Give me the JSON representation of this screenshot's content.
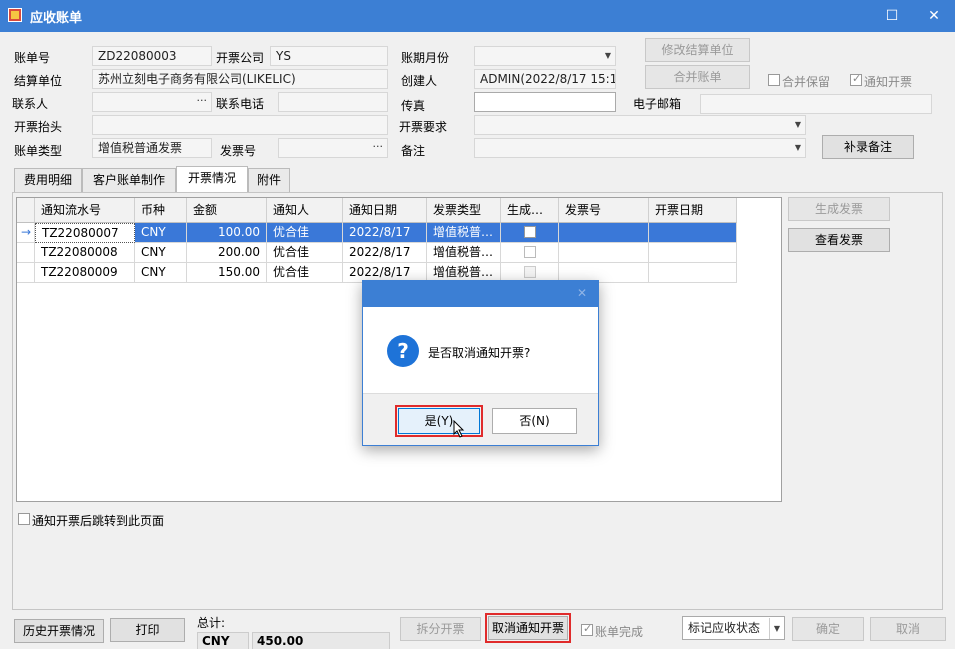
{
  "window": {
    "title": "应收账单",
    "minimize": "☐",
    "close": "✕"
  },
  "form": {
    "bill_no_label": "账单号",
    "bill_no": "ZD22080003",
    "invoice_company_label": "开票公司",
    "invoice_company": "YS",
    "period_label": "账期月份",
    "period": "",
    "settle_unit_label": "结算单位",
    "settle_unit": "苏州立刻电子商务有限公司(LIKELIC)",
    "creator_label": "创建人",
    "creator": "ADMIN(2022/8/17 15:1",
    "contact_label": "联系人",
    "contact": "",
    "phone_label": "联系电话",
    "phone": "",
    "fax_label": "传真",
    "fax": "",
    "email_label": "电子邮箱",
    "email": "",
    "invoice_title_label": "开票抬头",
    "invoice_title": "",
    "invoice_req_label": "开票要求",
    "invoice_req": "",
    "bill_type_label": "账单类型",
    "bill_type": "增值税普通发票",
    "invoice_no_label": "发票号",
    "invoice_no": "",
    "remark_label": "备注",
    "remark": ""
  },
  "buttons": {
    "modify_settle": "修改结算单位",
    "merge_bill": "合并账单",
    "add_remark": "补录备注",
    "gen_invoice": "生成发票",
    "view_invoice": "查看发票",
    "history": "历史开票情况",
    "print": "打印",
    "split": "拆分开票",
    "cancel_notify": "取消通知开票",
    "confirm": "确定",
    "cancel": "取消"
  },
  "checks": {
    "merge_keep": "合并保留",
    "notify": "通知开票",
    "jump": "通知开票后跳转到此页面",
    "bill_done": "账单完成"
  },
  "tabs": [
    "费用明细",
    "客户账单制作",
    "开票情况",
    "附件"
  ],
  "table": {
    "headers": [
      "通知流水号",
      "币种",
      "金额",
      "通知人",
      "通知日期",
      "发票类型",
      "生成…",
      "发票号",
      "开票日期"
    ],
    "rows": [
      {
        "marker": "→",
        "id": "TZ22080007",
        "currency": "CNY",
        "amount": "100.00",
        "notifier": "优合佳",
        "date": "2022/8/17",
        "type": "增值税普…"
      },
      {
        "marker": "",
        "id": "TZ22080008",
        "currency": "CNY",
        "amount": "200.00",
        "notifier": "优合佳",
        "date": "2022/8/17",
        "type": "增值税普…"
      },
      {
        "marker": "",
        "id": "TZ22080009",
        "currency": "CNY",
        "amount": "150.00",
        "notifier": "优合佳",
        "date": "2022/8/17",
        "type": "增值税普…"
      }
    ]
  },
  "footer": {
    "total_label": "总计:",
    "currency": "CNY",
    "amount": "450.00",
    "status_select": "标记应收状态"
  },
  "dialog": {
    "message": "是否取消通知开票?",
    "yes": "是(Y)",
    "no": "否(N)",
    "close": "✕"
  },
  "colors": {
    "titlebar": "#3c7fd4",
    "selection": "#3a78d8",
    "highlight": "#e02b2b"
  }
}
